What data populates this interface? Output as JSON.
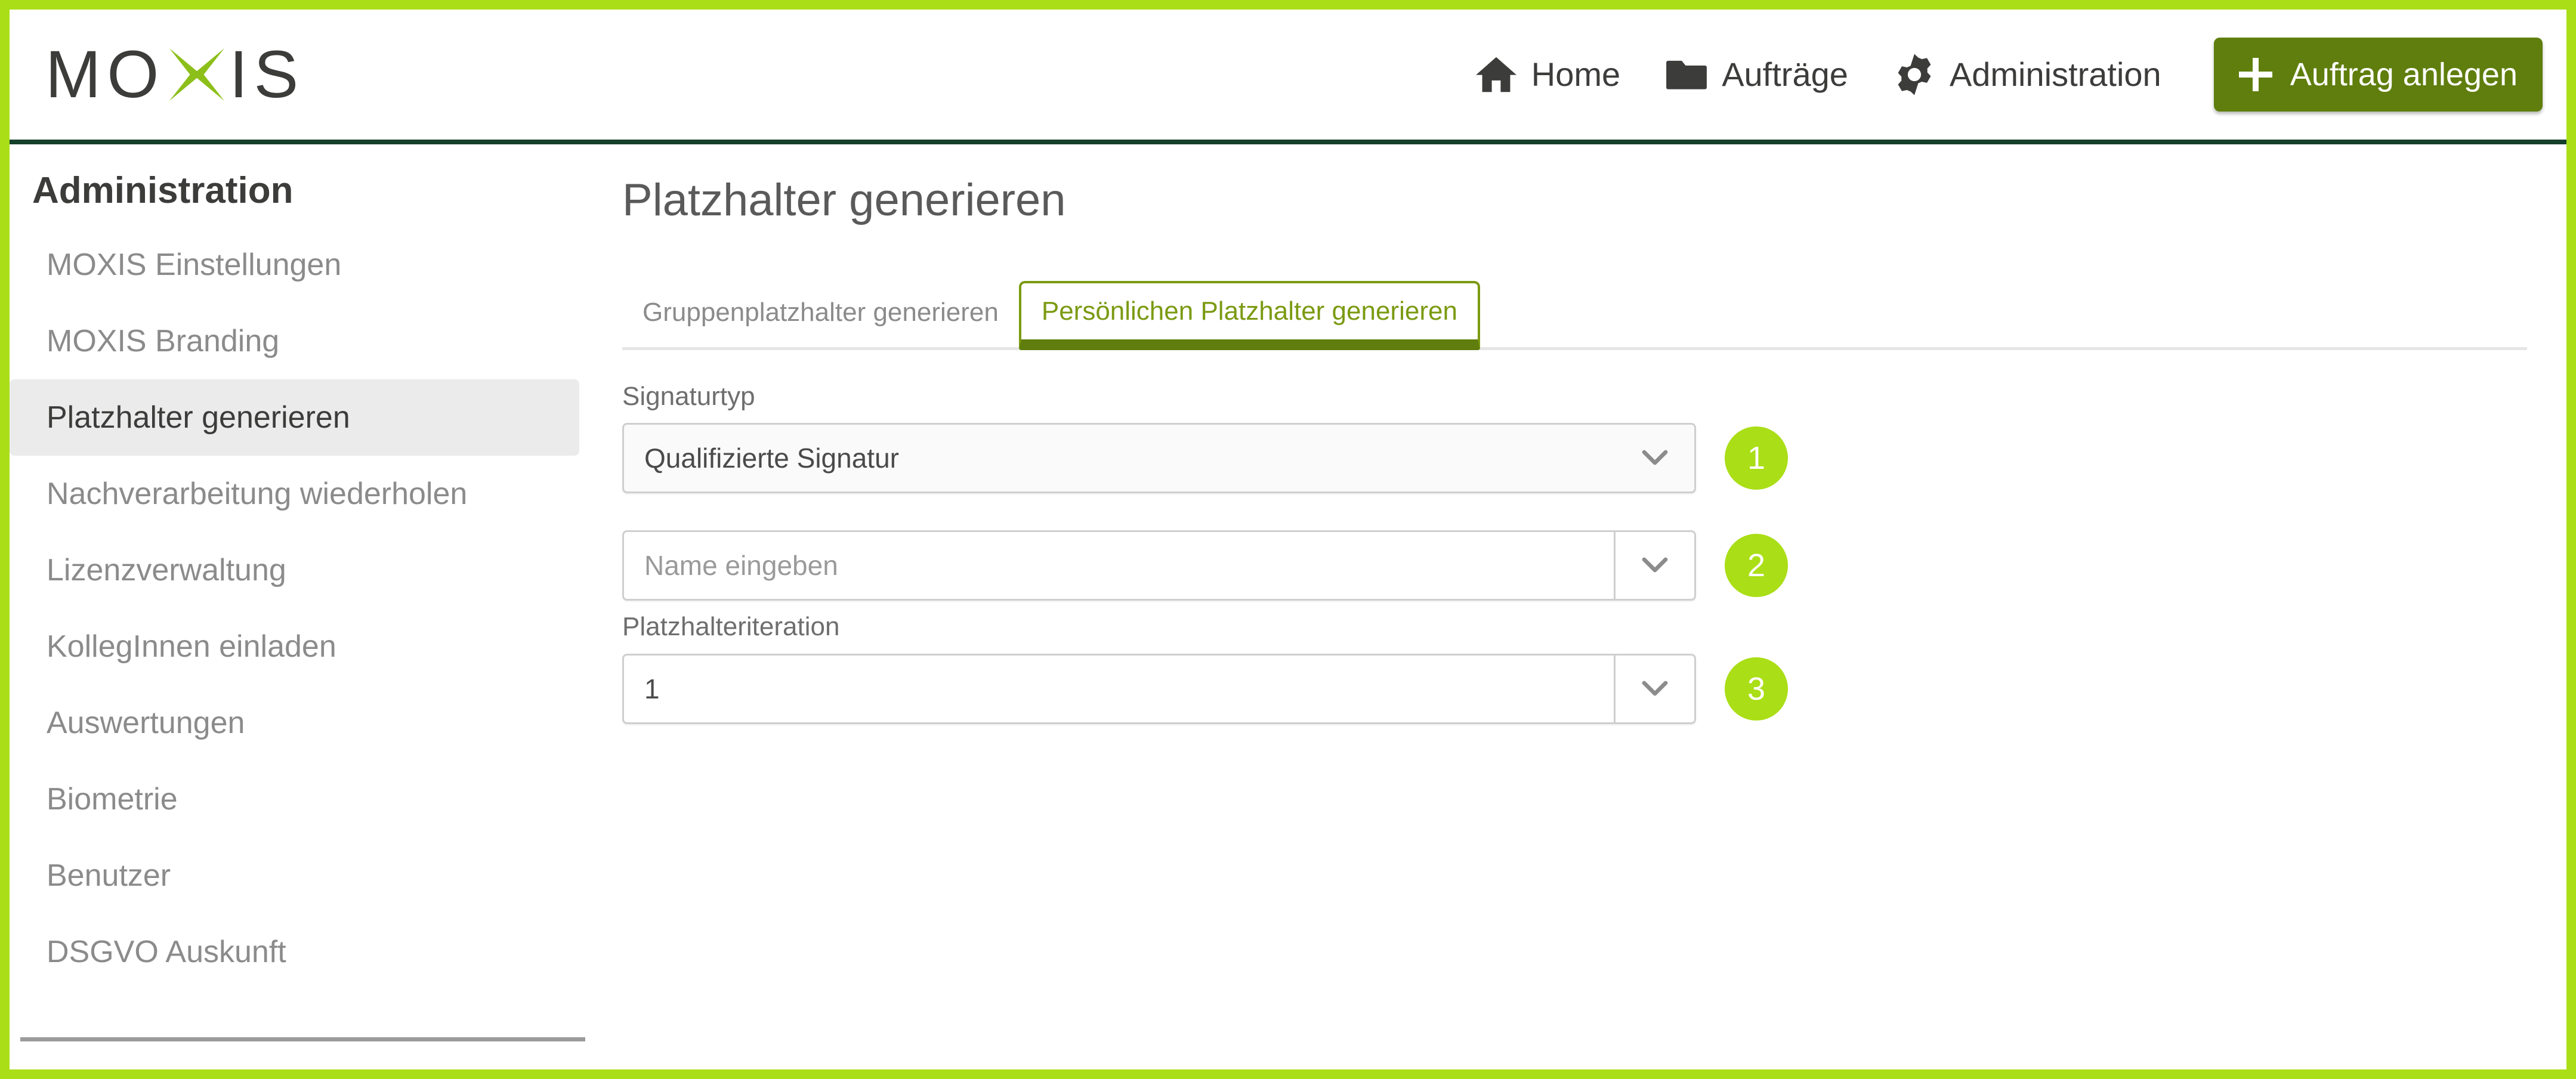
{
  "brand": {
    "name_before": "MO",
    "name_after": "IS",
    "x_icon": "moxis-x-mark",
    "accent": "#aade16",
    "dark_green": "#5f7e0d"
  },
  "header": {
    "nav": [
      {
        "label": "Home",
        "icon": "home-icon"
      },
      {
        "label": "Aufträge",
        "icon": "folder-icon"
      },
      {
        "label": "Administration",
        "icon": "gear-icon"
      }
    ],
    "cta": {
      "label": "Auftrag anlegen",
      "icon": "plus-icon"
    }
  },
  "sidebar": {
    "title": "Administration",
    "items": [
      {
        "label": "MOXIS Einstellungen",
        "active": false
      },
      {
        "label": "MOXIS Branding",
        "active": false
      },
      {
        "label": "Platzhalter generieren",
        "active": true
      },
      {
        "label": "Nachverarbeitung wiederholen",
        "active": false
      },
      {
        "label": "Lizenzverwaltung",
        "active": false
      },
      {
        "label": "KollegInnen einladen",
        "active": false
      },
      {
        "label": "Auswertungen",
        "active": false
      },
      {
        "label": "Biometrie",
        "active": false
      },
      {
        "label": "Benutzer",
        "active": false
      },
      {
        "label": "DSGVO Auskunft",
        "active": false
      }
    ]
  },
  "main": {
    "page_title": "Platzhalter generieren",
    "tabs": [
      {
        "label": "Gruppenplatzhalter generieren",
        "active": false
      },
      {
        "label": "Persönlichen Platzhalter generieren",
        "active": true
      }
    ],
    "form": {
      "signature_type": {
        "label": "Signaturtyp",
        "value": "Qualifizierte Signatur",
        "badge": "1",
        "icon": "chevron-down-icon"
      },
      "name": {
        "label": "",
        "placeholder": "Name eingeben",
        "value": "Name eingeben",
        "badge": "2",
        "icon": "chevron-down-icon"
      },
      "iteration": {
        "label": "Platzhalteriteration",
        "value": "1",
        "badge": "3",
        "icon": "chevron-down-icon"
      }
    }
  }
}
